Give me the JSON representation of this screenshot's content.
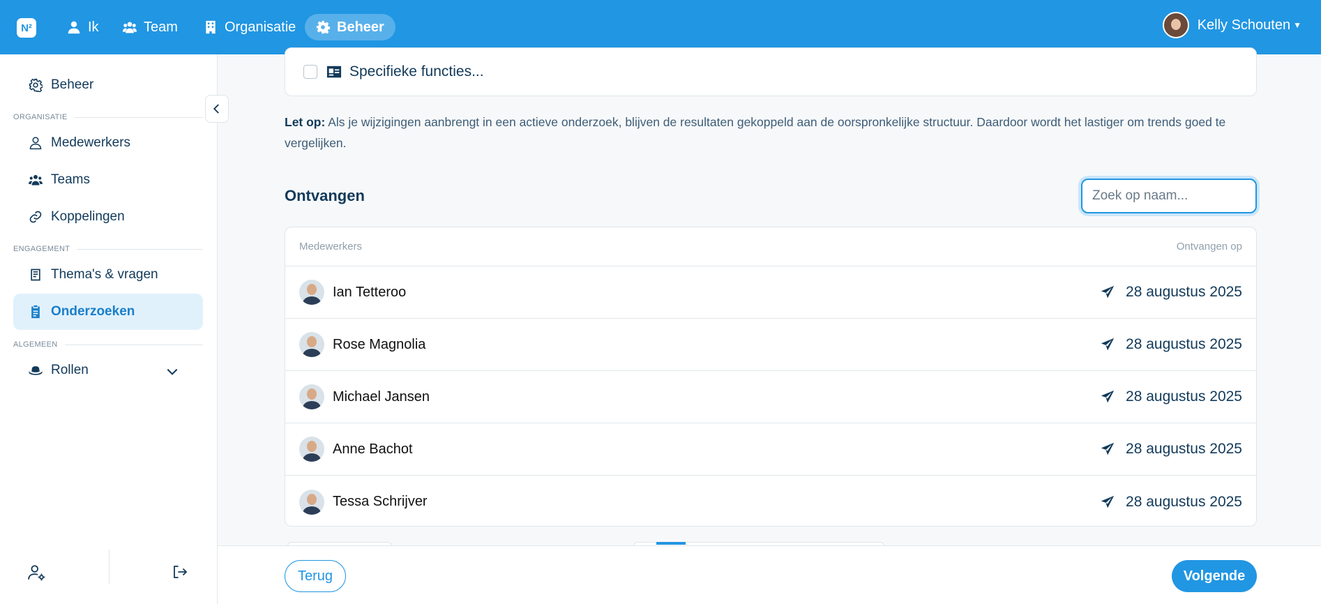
{
  "brand": {
    "logo_text": "N²",
    "accent": "#2196e3"
  },
  "topnav": {
    "items": [
      {
        "label": "Ik",
        "icon": "user-icon"
      },
      {
        "label": "Team",
        "icon": "users-icon"
      },
      {
        "label": "Organisatie",
        "icon": "building-icon"
      },
      {
        "label": "Beheer",
        "icon": "gear-icon",
        "active": true
      }
    ],
    "user_name": "Kelly Schouten"
  },
  "sidebar": {
    "top_item": "Beheer",
    "sections": [
      {
        "title": "ORGANISATIE",
        "items": [
          "Medewerkers",
          "Teams",
          "Koppelingen"
        ]
      },
      {
        "title": "ENGAGEMENT",
        "items": [
          "Thema's & vragen",
          "Onderzoeken"
        ]
      },
      {
        "title": "ALGEMEEN",
        "items": [
          "Rollen"
        ]
      }
    ],
    "active": "Onderzoeken"
  },
  "main": {
    "option_label": "Specifieke functies...",
    "note_bold": "Let op:",
    "note_text": " Als je wijzigingen aanbrengt in een actieve onderzoek, blijven de resultaten gekoppeld aan de oorspronkelijke structuur. Daardoor wordt het lastiger om trends goed te vergelijken.",
    "section_title": "Ontvangen",
    "search_placeholder": "Zoek op naam...",
    "table": {
      "col_left": "Medewerkers",
      "col_right": "Ontvangen op",
      "rows": [
        {
          "name": "Ian Tetteroo",
          "date": "28 augustus 2025"
        },
        {
          "name": "Rose Magnolia",
          "date": "28 augustus 2025"
        },
        {
          "name": "Michael Jansen",
          "date": "28 augustus 2025"
        },
        {
          "name": "Anne Bachot",
          "date": "28 augustus 2025"
        },
        {
          "name": "Tessa Schrijver",
          "date": "28 augustus 2025"
        }
      ]
    }
  },
  "footer": {
    "back_label": "Terug",
    "next_label": "Volgende"
  }
}
